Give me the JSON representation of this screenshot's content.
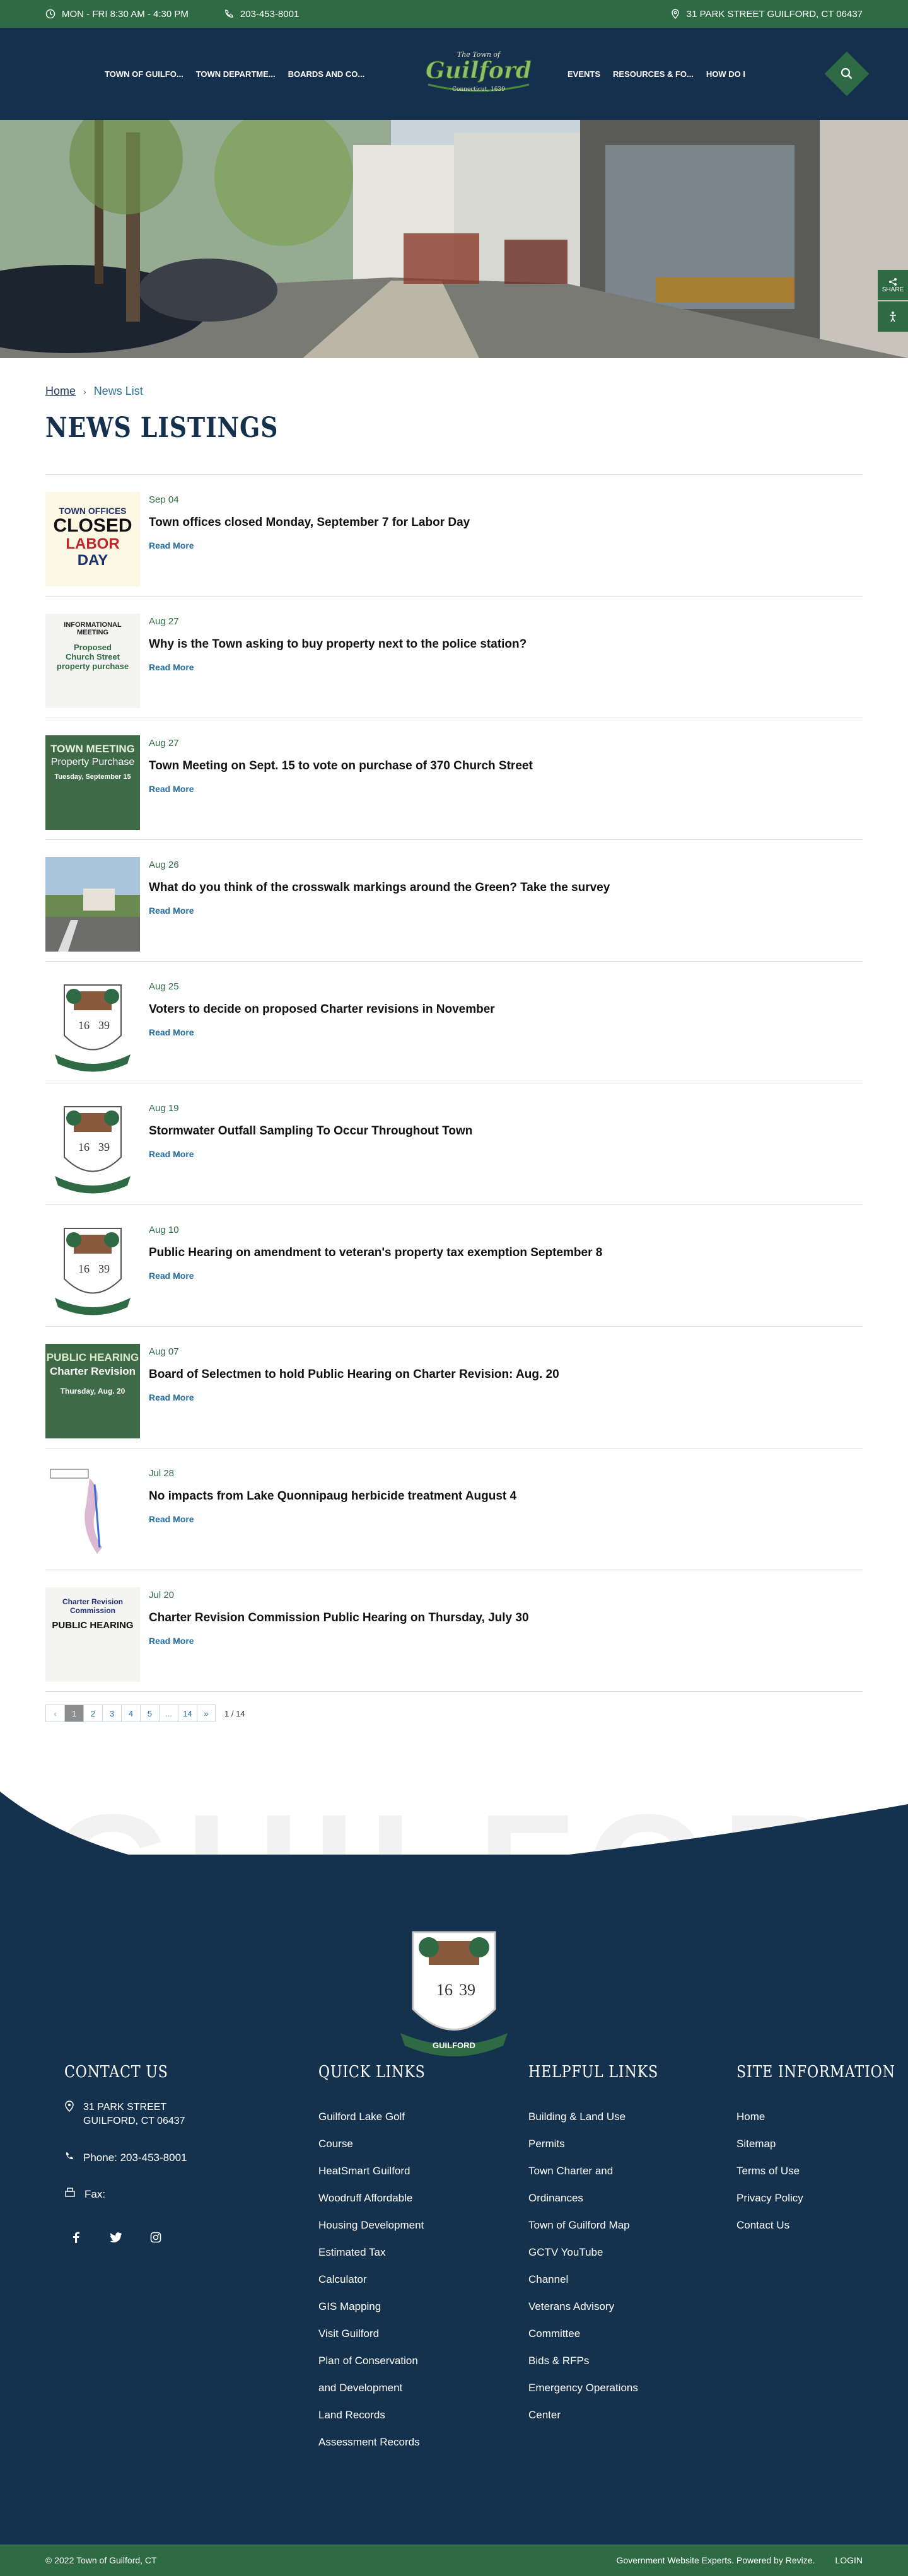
{
  "topbar": {
    "hours": "MON - FRI 8:30 AM - 4:30 PM",
    "phone": "203-453-8001",
    "address": "31 PARK STREET GUILFORD, CT 06437"
  },
  "nav": {
    "left": [
      "TOWN OF GUILFO...",
      "TOWN DEPARTME...",
      "BOARDS AND CO..."
    ],
    "right": [
      "EVENTS",
      "RESOURCES & FO...",
      "HOW DO I"
    ]
  },
  "logo": {
    "line1": "The Town of",
    "line2": "Guilford",
    "line3": "Connecticut, 1639"
  },
  "share": {
    "label": "SHARE"
  },
  "breadcrumb": {
    "home": "Home",
    "current": "News List"
  },
  "page_title": "NEWS LISTINGS",
  "news": [
    {
      "date": "Sep 04",
      "title": "Town offices closed Monday, September 7 for Labor Day",
      "read_more": "Read More",
      "thumb": {
        "l1": "TOWN OFFICES",
        "l2": "CLOSED",
        "l3": "LABOR",
        "l4": "DAY"
      }
    },
    {
      "date": "Aug 27",
      "title": "Why is the Town asking to buy property next to the police station?",
      "read_more": "Read More",
      "thumb": {
        "l1": "INFORMATIONAL",
        "l2": "MEETING",
        "l3": "Proposed",
        "l4": "Church Street",
        "l5": "property purchase"
      }
    },
    {
      "date": "Aug 27",
      "title": "Town Meeting on Sept. 15 to vote on purchase of 370 Church Street",
      "read_more": "Read More",
      "thumb": {
        "l1": "TOWN MEETING",
        "l2": "Property Purchase",
        "l3": "Tuesday, September 15"
      }
    },
    {
      "date": "Aug 26",
      "title": "What do you think of the crosswalk markings around the Green? Take the survey",
      "read_more": "Read More"
    },
    {
      "date": "Aug 25",
      "title": "Voters to decide on proposed Charter revisions in November",
      "read_more": "Read More"
    },
    {
      "date": "Aug 19",
      "title": "Stormwater Outfall Sampling To Occur Throughout Town",
      "read_more": "Read More"
    },
    {
      "date": "Aug 10",
      "title": "Public Hearing on amendment to veteran's property tax exemption September 8",
      "read_more": "Read More"
    },
    {
      "date": "Aug 07",
      "title": "Board of Selectmen to hold Public Hearing on Charter Revision: Aug. 20",
      "read_more": "Read More",
      "thumb": {
        "l1": "PUBLIC HEARING",
        "l2": "Charter Revision",
        "l3": "Thursday, Aug. 20"
      }
    },
    {
      "date": "Jul 28",
      "title": "No impacts from Lake Quonnipaug herbicide treatment August 4",
      "read_more": "Read More"
    },
    {
      "date": "Jul 20",
      "title": "Charter Revision Commission Public Hearing on Thursday, July 30",
      "read_more": "Read More",
      "thumb": {
        "l1": "Charter Revision",
        "l2": "Commission",
        "l3": "PUBLIC HEARING"
      }
    }
  ],
  "pagination": {
    "prev": "‹",
    "pages": [
      "1",
      "2",
      "3",
      "4",
      "5",
      "...",
      "14"
    ],
    "next": "»",
    "count": "1 / 14"
  },
  "footer": {
    "watermark": "GUILFORD",
    "seal_text": "GUILFORD",
    "seal_year_left": "16",
    "seal_year_right": "39",
    "contact": {
      "heading": "CONTACT US",
      "address1": "31 PARK STREET",
      "address2": "GUILFORD, CT 06437",
      "phone": "Phone: 203-453-8001",
      "fax": "Fax:"
    },
    "quick_links": {
      "heading": "QUICK LINKS",
      "items": [
        "Guilford Lake Golf",
        "Course",
        "HeatSmart Guilford",
        "Woodruff Affordable",
        "Housing Development",
        "Estimated Tax",
        "Calculator",
        "GIS Mapping",
        "Visit Guilford",
        "Plan of Conservation",
        "and Development",
        "Land Records",
        "Assessment Records"
      ]
    },
    "helpful_links": {
      "heading": "HELPFUL LINKS",
      "items": [
        "Building & Land Use",
        "Permits",
        "Town Charter and",
        "Ordinances",
        "Town of Guilford Map",
        "GCTV YouTube",
        "Channel",
        "Veterans Advisory",
        "Committee",
        "Bids & RFPs",
        "Emergency Operations",
        "Center"
      ]
    },
    "site_info": {
      "heading": "SITE INFORMATION",
      "items": [
        "Home",
        "Sitemap",
        "Terms of Use",
        "Privacy Policy",
        "Contact Us"
      ]
    },
    "copyright": "© 2022 Town of Guilford, CT",
    "powered": "Government Website Experts. Powered by Revize.",
    "login": "LOGIN"
  },
  "colors": {
    "green": "#2e6a44",
    "navy": "#15304d",
    "link": "#236fa1"
  }
}
